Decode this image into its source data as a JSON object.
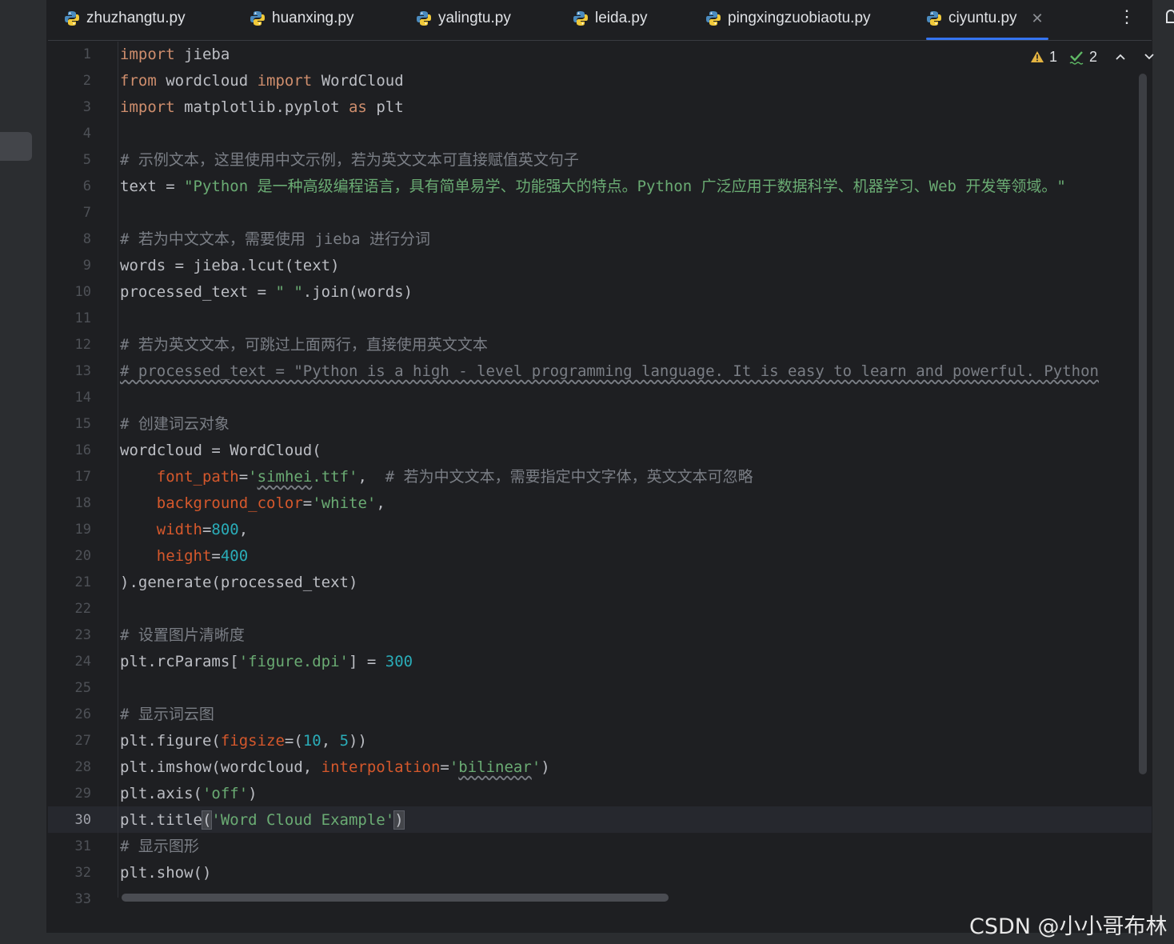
{
  "tabs": [
    {
      "label": "zhuzhangtu.py"
    },
    {
      "label": "huanxing.py"
    },
    {
      "label": "yalingtu.py"
    },
    {
      "label": "leida.py"
    },
    {
      "label": "pingxingzuobiaotu.py"
    },
    {
      "label": "ciyuntu.py"
    }
  ],
  "active_tab": "ciyuntu.py",
  "inspections": {
    "warnings": "1",
    "typos": "2"
  },
  "current_line": "30",
  "colors": {
    "background": "#1e1f22",
    "keyword": "#cf8e6d",
    "string": "#6aab73",
    "number": "#2aacb8",
    "comment": "#7a7e85",
    "param": "#d5582c",
    "tab_underline": "#3574f0"
  },
  "icons": [
    "python-file-icon",
    "close-icon",
    "more-vertical-icon",
    "warning-icon",
    "typo-check-icon",
    "chevron-up-icon",
    "chevron-down-icon",
    "notification-bell-icon"
  ],
  "line_numbers": [
    "1",
    "2",
    "3",
    "4",
    "5",
    "6",
    "7",
    "8",
    "9",
    "10",
    "11",
    "12",
    "13",
    "14",
    "15",
    "16",
    "17",
    "18",
    "19",
    "20",
    "21",
    "22",
    "23",
    "24",
    "25",
    "26",
    "27",
    "28",
    "29",
    "30",
    "31",
    "32",
    "33"
  ],
  "code": {
    "l1": [
      "import",
      " jieba"
    ],
    "l2": [
      "from",
      " wordcloud ",
      "import",
      " WordCloud"
    ],
    "l3": [
      "import",
      " matplotlib.pyplot ",
      "as",
      " plt"
    ],
    "l5": "# 示例文本，这里使用中文示例，若为英文文本可直接赋值英文句子",
    "l6": [
      "text = ",
      "\"Python 是一种高级编程语言，具有简单易学、功能强大的特点。Python 广泛应用于数据科学、机器学习、Web 开发等领域。\""
    ],
    "l8": "# 若为中文文本，需要使用 jieba 进行分词",
    "l9": "words = jieba.lcut(text)",
    "l10": [
      "processed_text = ",
      "\" \"",
      ".join(words)"
    ],
    "l12": "# 若为英文文本，可跳过上面两行，直接使用英文文本",
    "l13": "# processed_text = \"Python is a high - level programming language. It is easy to learn and powerful. Python",
    "l15": "# 创建词云对象",
    "l16": "wordcloud = WordCloud(",
    "l17": [
      "    ",
      "font_path",
      "=",
      "'",
      "simhei",
      ".ttf'",
      ",  ",
      "# 若为中文文本，需要指定中文字体，英文文本可忽略"
    ],
    "l18": [
      "    ",
      "background_color",
      "=",
      "'white'",
      ","
    ],
    "l19": [
      "    ",
      "width",
      "=",
      "800",
      ","
    ],
    "l20": [
      "    ",
      "height",
      "=",
      "400"
    ],
    "l21": ").generate(processed_text)",
    "l23": "# 设置图片清晰度",
    "l24": [
      "plt.rcParams[",
      "'figure.dpi'",
      "] = ",
      "300"
    ],
    "l26": "# 显示词云图",
    "l27": [
      "plt.figure(",
      "figsize",
      "=(",
      "10",
      ", ",
      "5",
      "))"
    ],
    "l28": [
      "plt.imshow(wordcloud, ",
      "interpolation",
      "=",
      "'",
      "bilinear",
      "'",
      ")"
    ],
    "l29": [
      "plt.axis(",
      "'off'",
      ")"
    ],
    "l30": [
      "plt.title",
      "(",
      "'Word Cloud Example'",
      ")"
    ],
    "l31": "# 显示图形",
    "l32": "plt.show()"
  },
  "watermark": "CSDN @小小哥布林"
}
